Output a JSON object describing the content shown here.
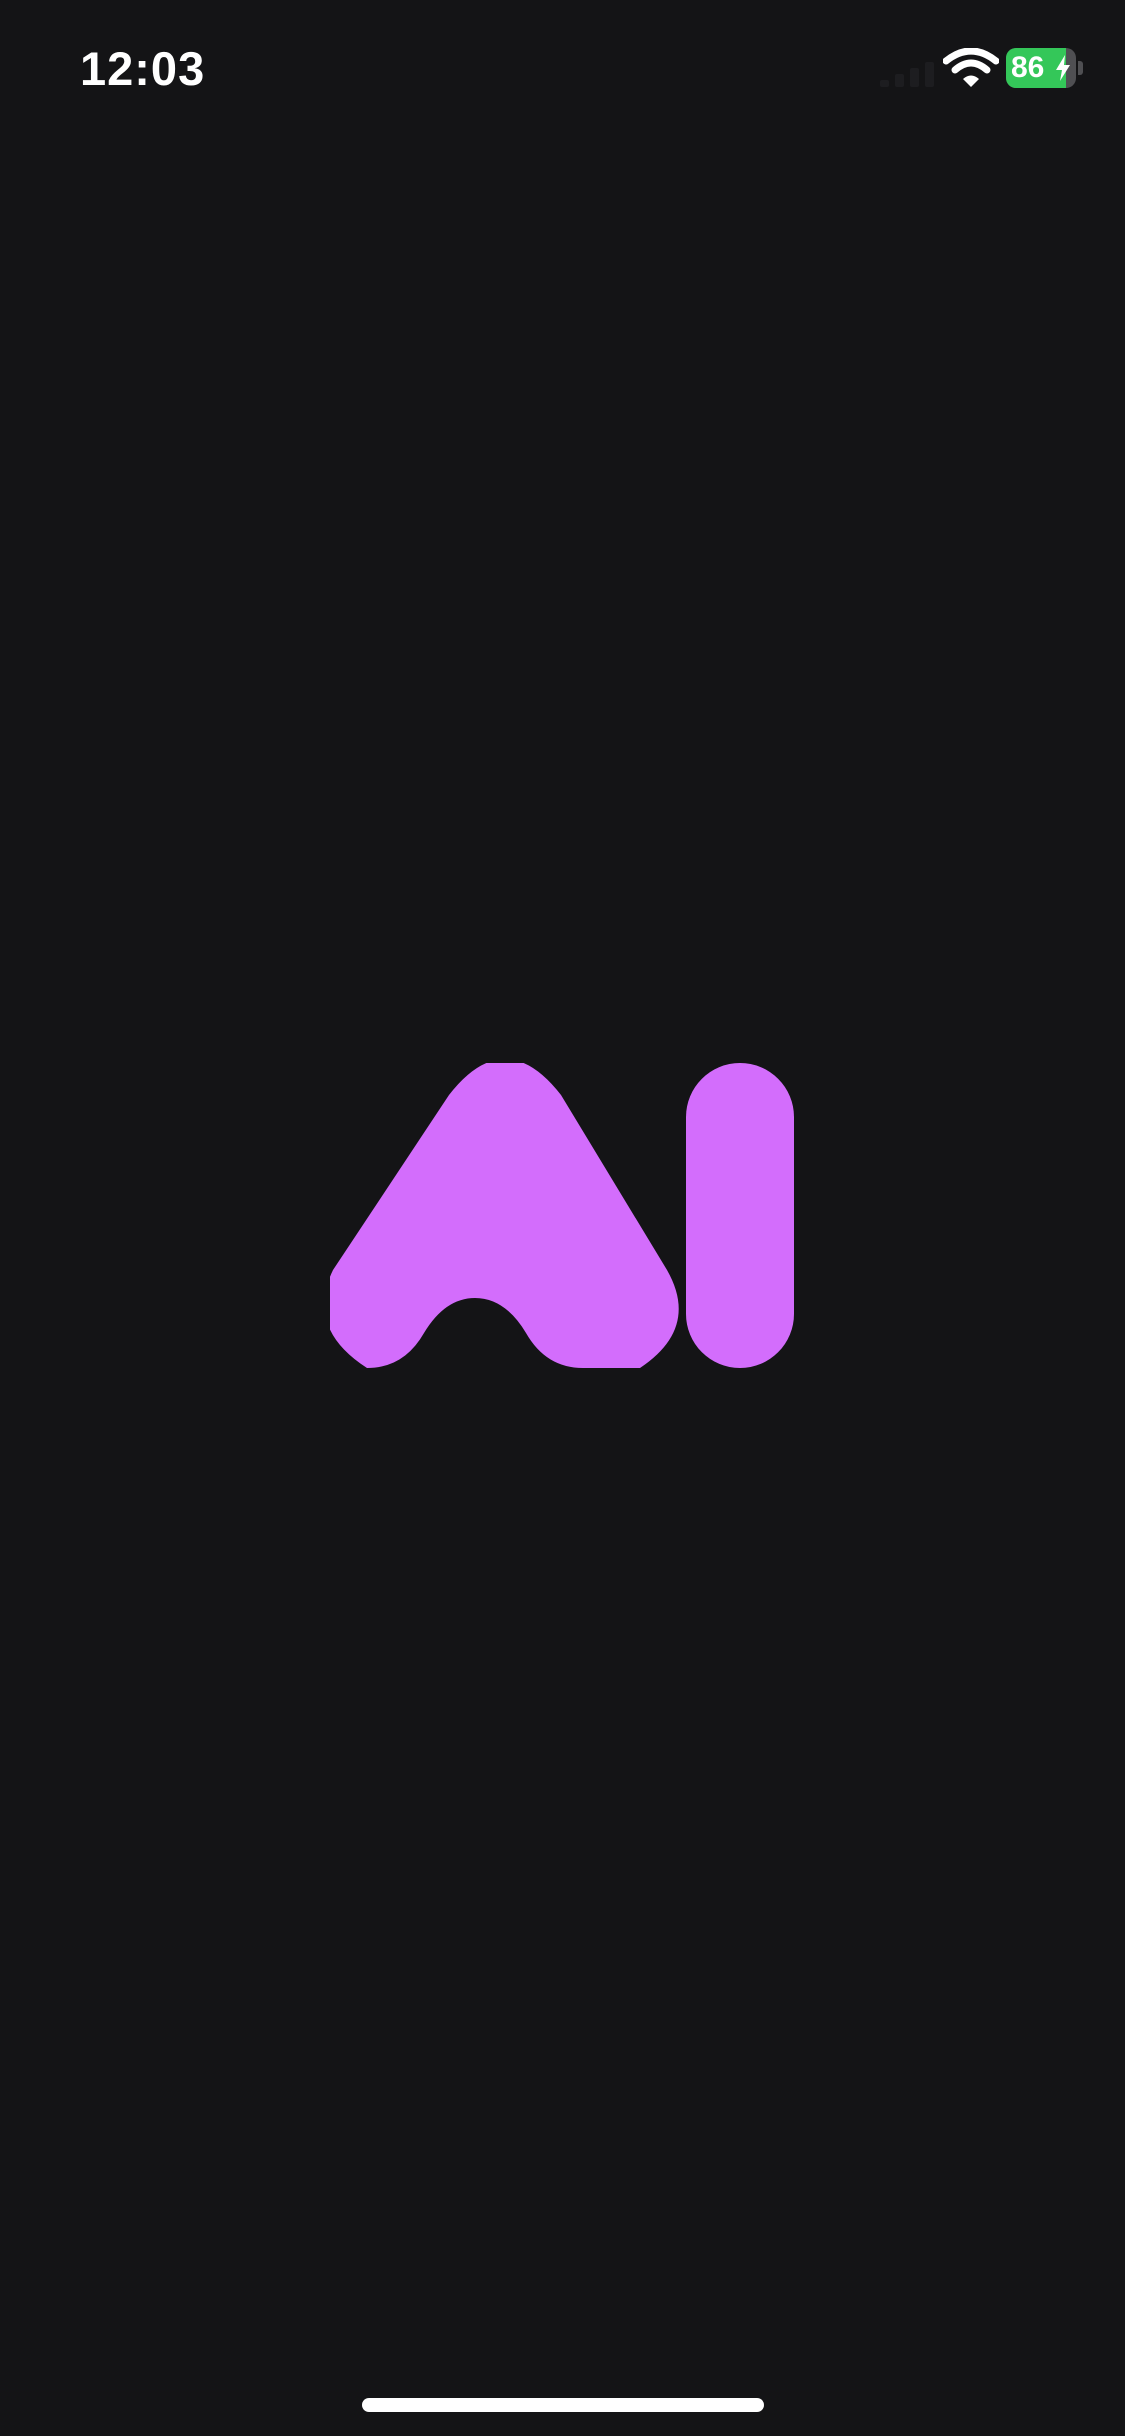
{
  "status_bar": {
    "time": "12:03",
    "battery_percent": 86,
    "battery_label": "86",
    "charging": true,
    "signal_icon": "cellular-signal-icon",
    "wifi_icon": "wifi-icon",
    "bolt_icon": "charging-bolt-icon"
  },
  "splash": {
    "logo_icon": "ai-logo-icon",
    "logo_text": "AI"
  },
  "colors": {
    "background": "#141416",
    "logo": "#d36dfc",
    "battery_fill": "#34c759",
    "text": "#ffffff"
  }
}
